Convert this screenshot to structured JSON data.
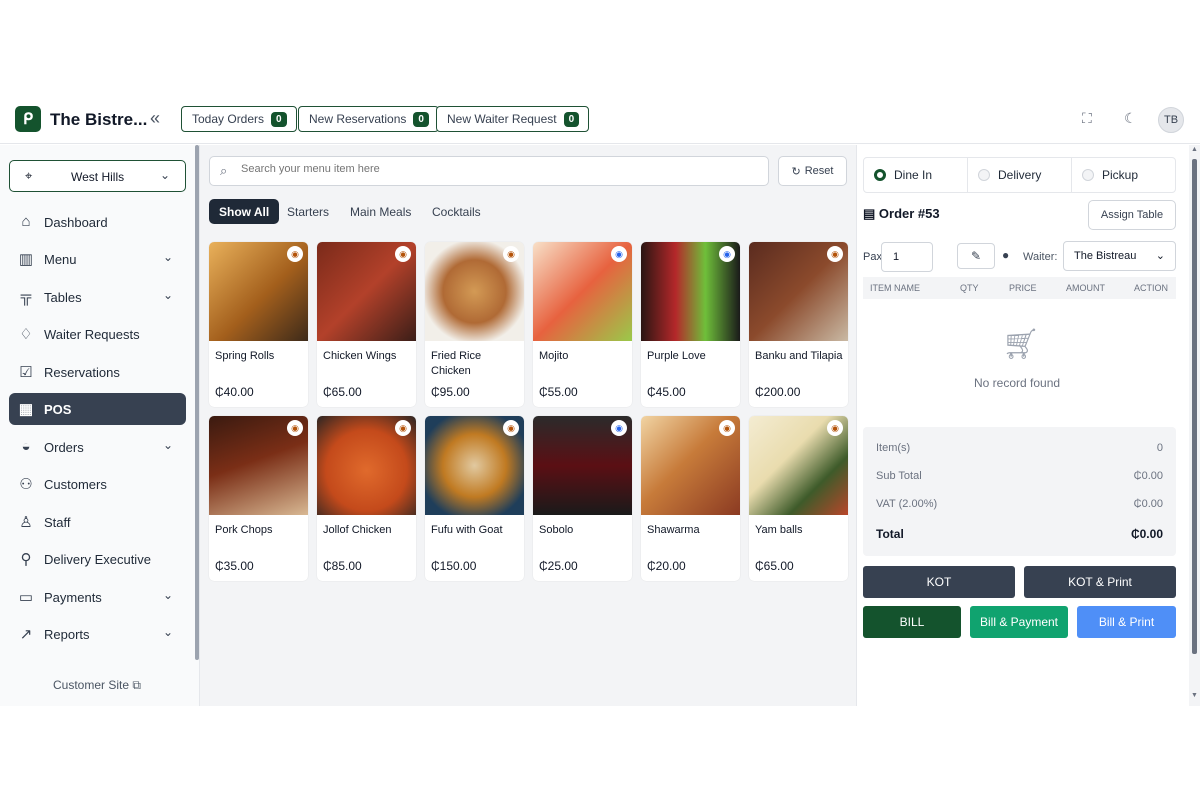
{
  "header": {
    "brand": "The Bistre...",
    "buttons": [
      {
        "label": "Today Orders",
        "count": "0"
      },
      {
        "label": "New Reservations",
        "count": "0"
      },
      {
        "label": "New Waiter Request",
        "count": "0"
      }
    ],
    "avatar": "TB"
  },
  "sidebar": {
    "location": "West Hills",
    "items": [
      {
        "label": "Dashboard",
        "icon": "home-icon"
      },
      {
        "label": "Menu",
        "icon": "menu-icon"
      },
      {
        "label": "Tables",
        "icon": "tables-icon"
      },
      {
        "label": "Waiter Requests",
        "icon": "bell-icon"
      },
      {
        "label": "Reservations",
        "icon": "calendar-icon"
      },
      {
        "label": "POS",
        "icon": "pos-icon"
      },
      {
        "label": "Orders",
        "icon": "orders-icon"
      },
      {
        "label": "Customers",
        "icon": "customers-icon"
      },
      {
        "label": "Staff",
        "icon": "staff-icon"
      },
      {
        "label": "Delivery Executive",
        "icon": "delivery-icon"
      },
      {
        "label": "Payments",
        "icon": "wallet-icon"
      },
      {
        "label": "Reports",
        "icon": "chart-icon"
      }
    ],
    "customer_site": "Customer Site"
  },
  "pos": {
    "search_placeholder": "Search your menu item here",
    "reset": "Reset",
    "categories": [
      "Show All",
      "Starters",
      "Main Meals",
      "Cocktails"
    ],
    "items": [
      {
        "name": "Spring Rolls",
        "price": "₵40.00"
      },
      {
        "name": "Chicken Wings",
        "price": "₵65.00"
      },
      {
        "name": "Fried Rice Chicken",
        "price": "₵95.00"
      },
      {
        "name": "Mojito",
        "price": "₵55.00"
      },
      {
        "name": "Purple Love",
        "price": "₵45.00"
      },
      {
        "name": "Banku and Tilapia",
        "price": "₵200.00"
      },
      {
        "name": "Pork Chops",
        "price": "₵35.00"
      },
      {
        "name": "Jollof Chicken",
        "price": "₵85.00"
      },
      {
        "name": "Fufu with Goat",
        "price": "₵150.00"
      },
      {
        "name": "Sobolo",
        "price": "₵25.00"
      },
      {
        "name": "Shawarma",
        "price": "₵20.00"
      },
      {
        "name": "Yam balls",
        "price": "₵65.00"
      }
    ]
  },
  "order": {
    "types": [
      "Dine In",
      "Delivery",
      "Pickup"
    ],
    "number": "Order #53",
    "assign_table": "Assign Table",
    "pax_label": "Pax",
    "pax_value": "1",
    "waiter_label": "Waiter:",
    "waiter_value": "The Bistreau",
    "columns": [
      "ITEM NAME",
      "QTY",
      "PRICE",
      "AMOUNT",
      "ACTION"
    ],
    "empty": "No record found",
    "items_label": "Item(s)",
    "items_value": "0",
    "subtotal_label": "Sub Total",
    "subtotal_value": "₵0.00",
    "vat_label": "VAT (2.00%)",
    "vat_value": "₵0.00",
    "total_label": "Total",
    "total_value": "₵0.00",
    "actions": [
      "KOT",
      "KOT & Print",
      "BILL",
      "Bill & Payment",
      "Bill & Print"
    ]
  }
}
